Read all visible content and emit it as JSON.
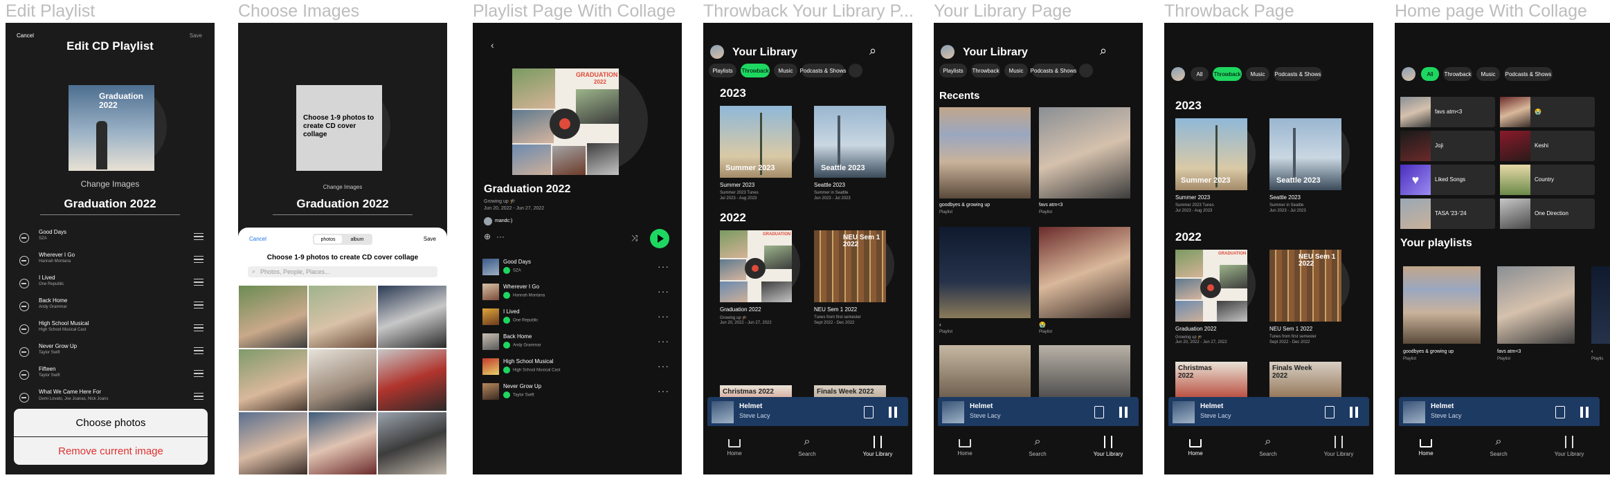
{
  "labels": [
    "Edit Playlist",
    "Choose Images",
    "Playlist Page With Collage",
    "Throwback Your Library P...",
    "Your Library Page",
    "Throwback Page",
    "Home page With Collage"
  ],
  "tracks": [
    {
      "title": "Good Days",
      "artist": "SZA"
    },
    {
      "title": "Wherever I Go",
      "artist": "Hannah Montana"
    },
    {
      "title": "I Lived",
      "artist": "One Republic"
    },
    {
      "title": "Back Home",
      "artist": "Andy Grammar"
    },
    {
      "title": "High School Musical",
      "artist": "High School Musical Cast"
    },
    {
      "title": "Never Grow Up",
      "artist": "Taylor Swift"
    },
    {
      "title": "Fifteen",
      "artist": "Taylor Swift"
    },
    {
      "title": "What We Came Here For",
      "artist": "Demi Lovato, Joe Joanas, Nick Joans"
    }
  ],
  "edit": {
    "cancel": "Cancel",
    "title": "Edit CD Playlist",
    "save": "Save",
    "cover_text": "Graduation 2022",
    "change_images": "Change Images",
    "playlist_name": "Graduation 2022",
    "choose_photos": "Choose photos",
    "remove_image": "Remove current image"
  },
  "choose": {
    "placeholder_text": "Choose 1-9 photos to create CD cover collage",
    "change_images": "Change Images",
    "playlist_name": "Graduation 2022",
    "cancel": "Cancel",
    "tab_photos": "photos",
    "tab_album": "album",
    "save": "Save",
    "instruction": "Choose 1-9 photos to create CD cover collage",
    "search_placeholder": "Photos, People, Places..."
  },
  "playlist": {
    "cover_title": "GRADUATION",
    "cover_year": "2022",
    "title": "Graduation 2022",
    "description": "Growing up 🎓",
    "dates": "Jun 20, 2022 - Jun 27, 2022",
    "owner": "mandc:)"
  },
  "library": {
    "title": "Your Library",
    "filters": [
      "Playlists",
      "Throwback",
      "Music",
      "Podcasts & Shows"
    ],
    "year_2023": "2023",
    "year_2022": "2022",
    "summer_title": "Summer 2023",
    "summer_cover": "Summer 2023",
    "summer_desc": "Summer 2023 Tunes",
    "summer_dates": "Jul 2023 - Aug 2023",
    "seattle_title": "Seattle 2023",
    "seattle_cover": "Seattle 2023",
    "seattle_desc": "Summer in Seattle",
    "seattle_dates": "Jun 2023 - Jul 2023",
    "grad_title": "Graduation 2022",
    "grad_desc": "Growing up 🎓",
    "grad_dates": "Jun 20, 2022 - Jun 27, 2022",
    "neu_title": "NEU Sem 1 2022",
    "neu_cover": "NEU Sem 1 2022",
    "neu_desc": "Tunes from first semester",
    "neu_dates": "Sept 2022 - Dec 2022",
    "christmas_cover": "Christmas 2022",
    "finals_cover": "Finals Week 2022"
  },
  "yourlib": {
    "recents": "Recents",
    "item1_title": "goodbyes & growing up",
    "item1_type": "Playlist",
    "item2_title": "favs atm<3",
    "item2_type": "Playlist",
    "item3_title": "‹",
    "item3_type": "Playlist",
    "item4_title": "😭",
    "item4_type": "Playlist"
  },
  "throwback": {
    "filters": [
      "All",
      "Throwback",
      "Music",
      "Podcasts & Shows"
    ]
  },
  "home": {
    "filters": [
      "All",
      "Throwback",
      "Music",
      "Podcasts & Shows"
    ],
    "tiles": [
      "favs atm<3",
      "😭",
      "Joji",
      "Keshi",
      "Liked Songs",
      "Country",
      "TASA '23-'24",
      "One Direction"
    ],
    "your_playlists": "Your playlists",
    "pl1_title": "goodbyes & growing up",
    "pl1_type": "Playlist",
    "pl2_title": "favs atm<3",
    "pl2_type": "Playlist",
    "pl3_title": "‹",
    "pl3_type": "Playlis"
  },
  "player": {
    "title": "Helmet",
    "artist": "Steve Lacy"
  },
  "nav": {
    "home": "Home",
    "search": "Search",
    "library": "Your Library"
  },
  "colors": {
    "accent": "#1ed760",
    "background": "#121212",
    "player": "#1d3a63",
    "danger": "#e03131"
  }
}
